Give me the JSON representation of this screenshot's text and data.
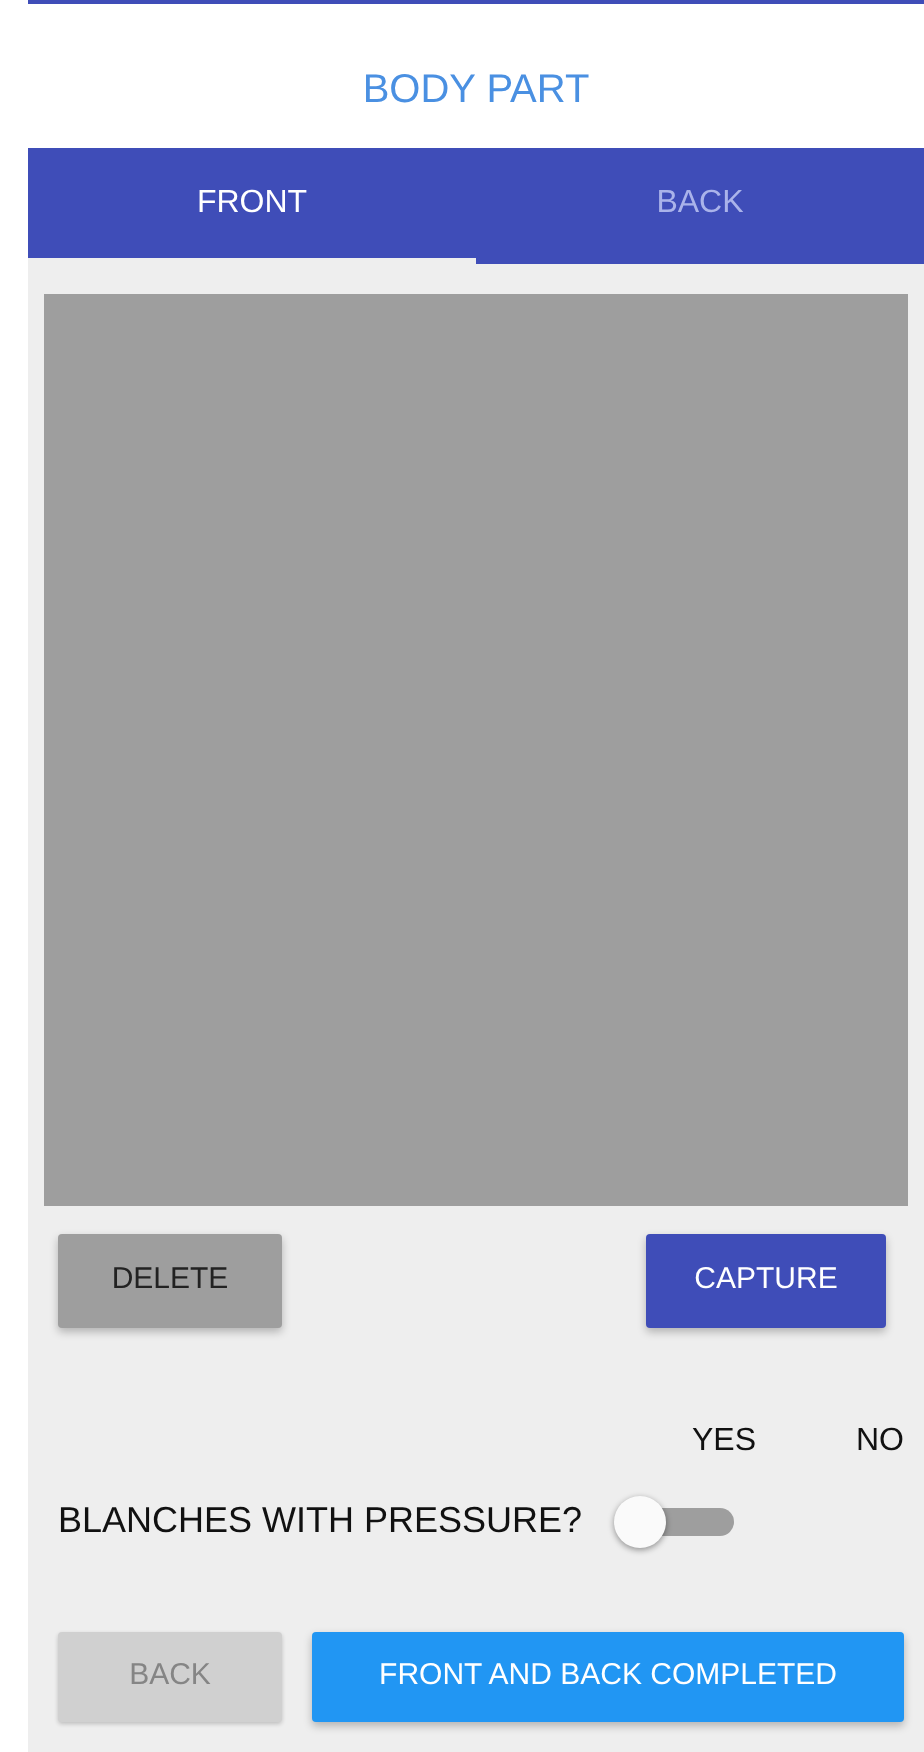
{
  "title": "BODY PART",
  "tabs": [
    {
      "label": "FRONT",
      "selected": true
    },
    {
      "label": "BACK",
      "selected": false
    }
  ],
  "actions": [
    {
      "label": "DELETE",
      "kind": "secondary"
    },
    {
      "label": "CAPTURE",
      "kind": "primary"
    }
  ],
  "question": {
    "yes_label": "YES",
    "no_label": "NO",
    "label": "BLANCHES WITH PRESSURE?",
    "on": false
  },
  "footer": [
    {
      "label": "BACK",
      "disabled": true,
      "kind": "secondary"
    },
    {
      "label": "FRONT AND BACK COMPLETED",
      "disabled": false,
      "kind": "accent"
    }
  ]
}
